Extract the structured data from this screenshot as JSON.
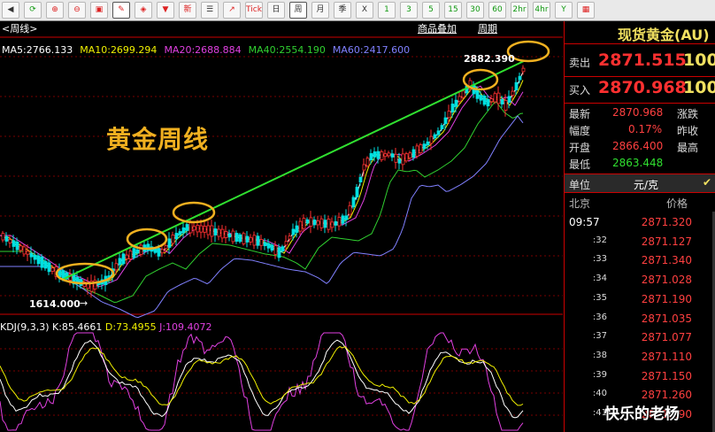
{
  "toolbar": {
    "buttons": [
      {
        "name": "back-icon",
        "glyph": "◀",
        "cls": ""
      },
      {
        "name": "refresh-icon",
        "glyph": "⟳",
        "cls": "green"
      },
      {
        "name": "zoom-in-icon",
        "glyph": "⊕",
        "cls": "red"
      },
      {
        "name": "zoom-out-icon",
        "glyph": "⊖",
        "cls": "red"
      },
      {
        "name": "window-icon",
        "glyph": "▣",
        "cls": "red"
      },
      {
        "name": "pen-icon",
        "glyph": "✎",
        "cls": "red",
        "active": true
      },
      {
        "name": "fill-icon",
        "glyph": "◈",
        "cls": "red"
      },
      {
        "name": "filter-icon",
        "glyph": "▼",
        "cls": "red"
      },
      {
        "name": "new-icon",
        "glyph": "新",
        "cls": "red"
      },
      {
        "name": "list-icon",
        "glyph": "☰",
        "cls": ""
      },
      {
        "name": "chart-icon",
        "glyph": "↗",
        "cls": "red"
      },
      {
        "name": "tick-button",
        "glyph": "Tick",
        "cls": "red"
      },
      {
        "name": "day-button",
        "glyph": "日",
        "cls": ""
      },
      {
        "name": "week-button",
        "glyph": "周",
        "cls": "",
        "active": true
      },
      {
        "name": "month-button",
        "glyph": "月",
        "cls": ""
      },
      {
        "name": "season-button",
        "glyph": "季",
        "cls": ""
      },
      {
        "name": "x-button",
        "glyph": "X",
        "cls": ""
      },
      {
        "name": "min1-button",
        "glyph": "1",
        "cls": "green"
      },
      {
        "name": "min3-button",
        "glyph": "3",
        "cls": "green"
      },
      {
        "name": "min5-button",
        "glyph": "5",
        "cls": "green"
      },
      {
        "name": "min15-button",
        "glyph": "15",
        "cls": "green"
      },
      {
        "name": "min30-button",
        "glyph": "30",
        "cls": "green"
      },
      {
        "name": "min60-button",
        "glyph": "60",
        "cls": "green"
      },
      {
        "name": "hour2-button",
        "glyph": "2hr",
        "cls": "green"
      },
      {
        "name": "hour4-button",
        "glyph": "4hr",
        "cls": "green"
      },
      {
        "name": "year-button",
        "glyph": "Y",
        "cls": "green"
      },
      {
        "name": "calendar-icon",
        "glyph": "▦",
        "cls": "red"
      }
    ]
  },
  "chart_header": {
    "tag": "<周线>",
    "overlay_link": "商品叠加",
    "period_link": "周期",
    "ma": [
      {
        "label": "MA5:2766.133",
        "color": "#ffffff"
      },
      {
        "label": "MA10:2699.294",
        "color": "#f0f000"
      },
      {
        "label": "MA20:2688.884",
        "color": "#e040e0"
      },
      {
        "label": "MA40:2554.190",
        "color": "#30d030"
      },
      {
        "label": "MA60:2417.600",
        "color": "#8080ff"
      }
    ]
  },
  "annotations": {
    "title": "黄金周线",
    "high": "2882.390",
    "low": "1614.000"
  },
  "kdj": {
    "name": "KDJ(9,3,3)",
    "k": "K:85.4661",
    "d": "D:73.4955",
    "j": "J:109.4072"
  },
  "colors": {
    "up": "#ff3030",
    "down": "#00e0e0",
    "trend": "#30e030",
    "circle": "#f0b020"
  },
  "chart_data": {
    "type": "candlestick",
    "ohlc_range": [
      1614.0,
      2882.39
    ],
    "high": 2882.39,
    "low": 1614.0,
    "series": [
      {
        "name": "MA5",
        "value": 2766.133
      },
      {
        "name": "MA10",
        "value": 2699.294
      },
      {
        "name": "MA20",
        "value": 2688.884
      },
      {
        "name": "MA40",
        "value": 2554.19
      },
      {
        "name": "MA60",
        "value": 2417.6
      }
    ],
    "kdj": {
      "K": 85.4661,
      "D": 73.4955,
      "J": 109.4072
    }
  },
  "quote": {
    "title": "现货黄金(AU)",
    "sell_label": "卖出",
    "sell_price": "2871.515",
    "sell_qty": "100",
    "buy_label": "买入",
    "buy_price": "2870.968",
    "buy_qty": "100",
    "latest_label": "最新",
    "latest_value": "2870.968",
    "change_label": "涨跌",
    "amp_label": "幅度",
    "amp_value": "0.17%",
    "prevclose_label": "昨收",
    "open_label": "开盘",
    "open_value": "2866.400",
    "high_label": "最高",
    "low_label": "最低",
    "low_value": "2863.448",
    "unit_label": "单位",
    "unit_value": "元/克",
    "city_label": "北京",
    "price_header": "价格"
  },
  "ticks": [
    {
      "t": "09:57",
      "p": "2871.320"
    },
    {
      "t": ":32",
      "p": "2871.127"
    },
    {
      "t": ":33",
      "p": "2871.340"
    },
    {
      "t": ":34",
      "p": "2871.028"
    },
    {
      "t": ":35",
      "p": "2871.190"
    },
    {
      "t": ":36",
      "p": "2871.035"
    },
    {
      "t": ":37",
      "p": "2871.077"
    },
    {
      "t": ":38",
      "p": "2871.110"
    },
    {
      "t": ":39",
      "p": "2871.150"
    },
    {
      "t": ":40",
      "p": "2871.260"
    },
    {
      "t": ":41",
      "p": "2871.290"
    }
  ],
  "watermark": "快乐的老杨"
}
